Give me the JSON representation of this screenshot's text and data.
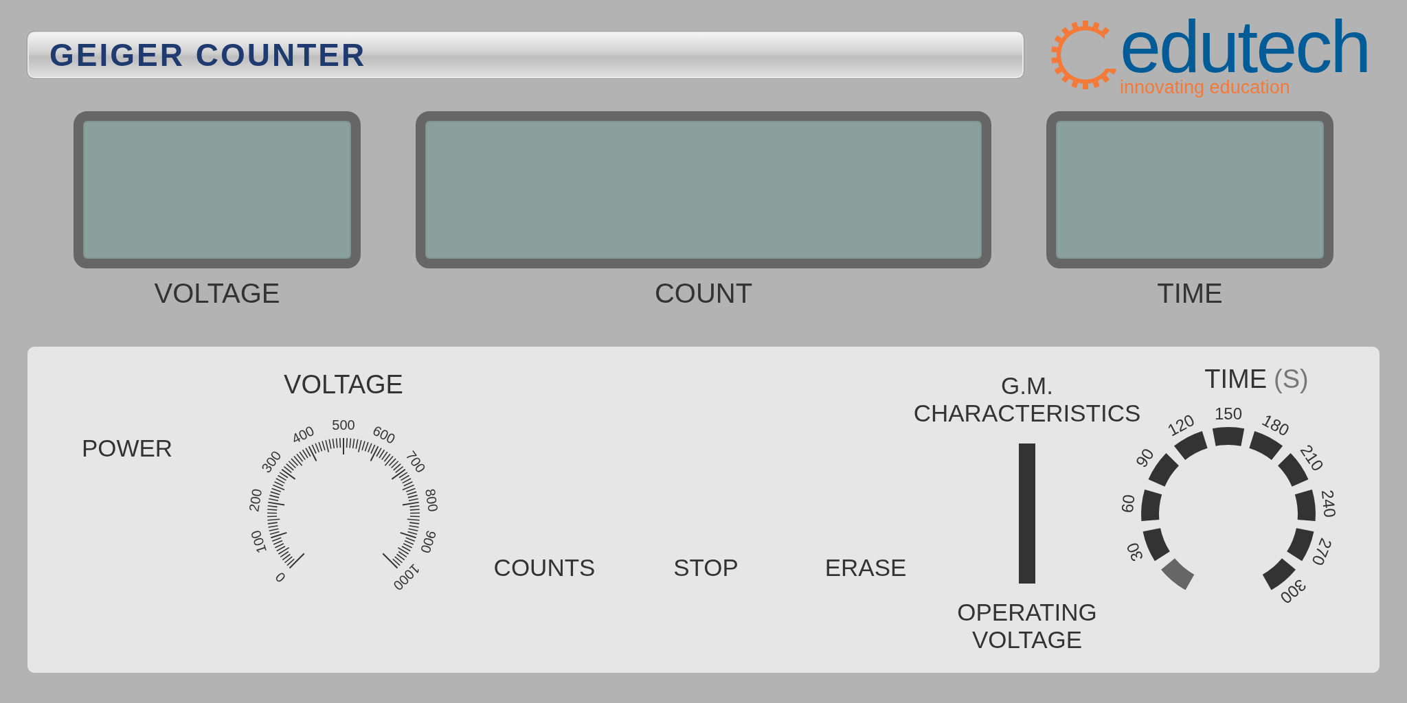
{
  "title": "GEIGER COUNTER",
  "logo": {
    "name": "edutech",
    "tagline": "innovating education"
  },
  "displays": [
    {
      "label": "VOLTAGE"
    },
    {
      "label": "COUNT"
    },
    {
      "label": "TIME"
    }
  ],
  "panel": {
    "power": {
      "label": "POWER"
    },
    "voltage_dial": {
      "label": "VOLTAGE",
      "scale": [
        "0",
        "100",
        "200",
        "300",
        "400",
        "500",
        "600",
        "700",
        "800",
        "900",
        "1000"
      ]
    },
    "buttons": [
      {
        "label": "COUNTS"
      },
      {
        "label": "STOP"
      },
      {
        "label": "ERASE"
      }
    ],
    "mode_switch": {
      "top_label": [
        "G.M.",
        "CHARACTERISTICS"
      ],
      "bottom_label": [
        "OPERATING",
        "VOLTAGE"
      ]
    },
    "time_dial": {
      "label": "TIME",
      "unit": "(S)",
      "scale": [
        "30",
        "60",
        "90",
        "120",
        "150",
        "180",
        "210",
        "240",
        "270",
        "300"
      ]
    }
  }
}
